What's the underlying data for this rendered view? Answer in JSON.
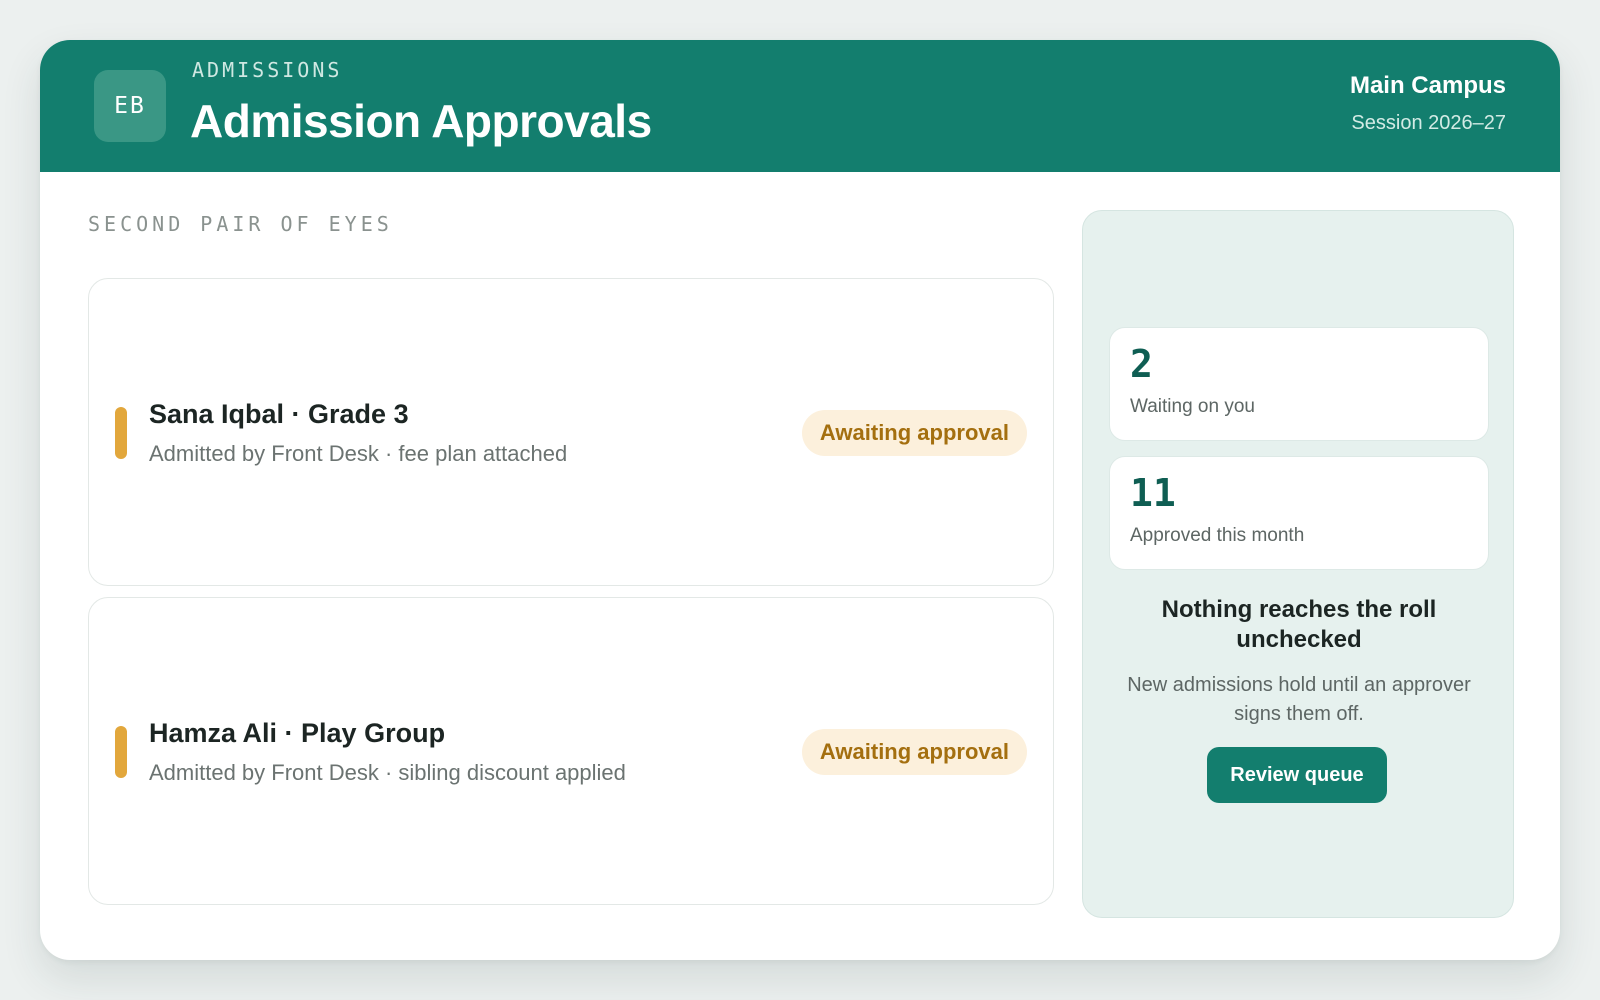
{
  "header": {
    "logo_initials": "EB",
    "eyebrow": "ADMISSIONS",
    "title": "Admission Approvals",
    "campus": "Main Campus",
    "session": "Session 2026–27"
  },
  "section_label": "SECOND PAIR OF EYES",
  "approvals": [
    {
      "name": "Sana Iqbal · Grade 3",
      "meta": "Admitted by Front Desk · fee plan attached",
      "status": "Awaiting approval"
    },
    {
      "name": "Hamza Ali · Play Group",
      "meta": "Admitted by Front Desk · sibling discount applied",
      "status": "Awaiting approval"
    }
  ],
  "sidebar": {
    "stats": [
      {
        "value": "2",
        "label": "Waiting on you"
      },
      {
        "value": "11",
        "label": "Approved this month"
      }
    ],
    "title": "Nothing reaches the roll unchecked",
    "description": "New admissions hold until an approver signs them off.",
    "button_label": "Review queue"
  },
  "colors": {
    "brand": "#137e6e",
    "accent_pending": "#e2a73c",
    "badge_bg": "#fcf0dc",
    "badge_text": "#a46f0f",
    "panel_bg": "#e6f1ee"
  }
}
